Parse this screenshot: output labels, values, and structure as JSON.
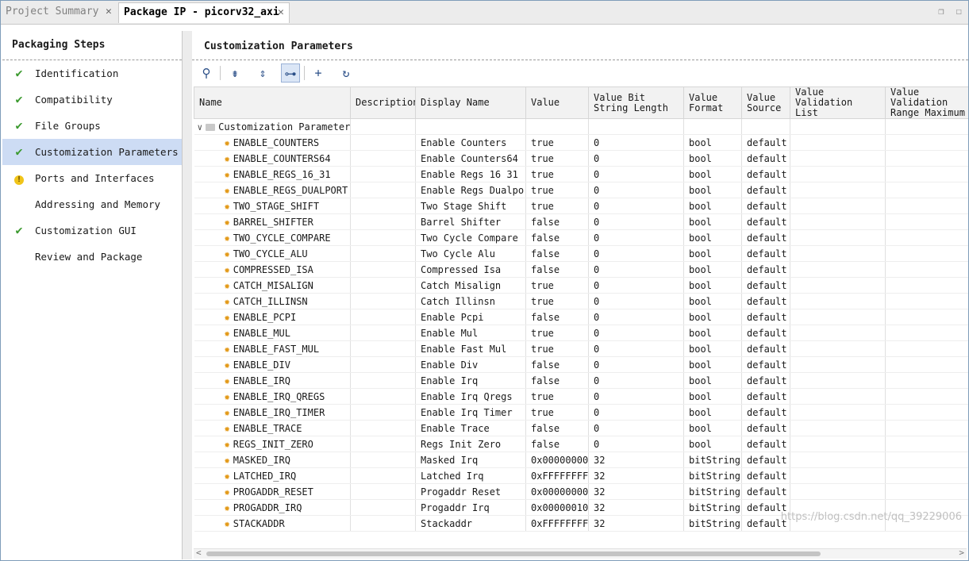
{
  "tabs": [
    {
      "label": "Project Summary",
      "close": "✕",
      "active": false
    },
    {
      "label": "Package IP - picorv32_axi",
      "close": "✕",
      "active": true
    }
  ],
  "window_buttons": {
    "restore": "❐",
    "maximize": "☐"
  },
  "steps": {
    "title": "Packaging Steps",
    "items": [
      {
        "label": "Identification",
        "status": "check"
      },
      {
        "label": "Compatibility",
        "status": "check"
      },
      {
        "label": "File Groups",
        "status": "check"
      },
      {
        "label": "Customization Parameters",
        "status": "check",
        "selected": true
      },
      {
        "label": "Ports and Interfaces",
        "status": "warning"
      },
      {
        "label": "Addressing and Memory",
        "status": "none"
      },
      {
        "label": "Customization GUI",
        "status": "check"
      },
      {
        "label": "Review and Package",
        "status": "none"
      }
    ]
  },
  "main": {
    "title": "Customization Parameters",
    "toolbar": [
      {
        "icon": "search-icon",
        "glyph": "⚲"
      },
      {
        "icon": "collapse-all-icon",
        "glyph": "⇟"
      },
      {
        "icon": "expand-all-icon",
        "glyph": "⇕"
      },
      {
        "icon": "group-hierarchy-icon",
        "glyph": "⊶"
      },
      {
        "icon": "add-icon",
        "glyph": "+"
      },
      {
        "icon": "refresh-icon",
        "glyph": "↻"
      }
    ],
    "columns": [
      "Name",
      "Description",
      "Display Name",
      "Value",
      "Value Bit String Length",
      "Value Format",
      "Value Source",
      "Value Validation List",
      "Value Validation Range Maximum"
    ],
    "group_label": "Customization Parameters",
    "rows": [
      [
        "ENABLE_COUNTERS",
        "",
        "Enable Counters",
        "true",
        "0",
        "bool",
        "default"
      ],
      [
        "ENABLE_COUNTERS64",
        "",
        "Enable Counters64",
        "true",
        "0",
        "bool",
        "default"
      ],
      [
        "ENABLE_REGS_16_31",
        "",
        "Enable Regs 16 31",
        "true",
        "0",
        "bool",
        "default"
      ],
      [
        "ENABLE_REGS_DUALPORT",
        "",
        "Enable Regs Dualport",
        "true",
        "0",
        "bool",
        "default"
      ],
      [
        "TWO_STAGE_SHIFT",
        "",
        "Two Stage Shift",
        "true",
        "0",
        "bool",
        "default"
      ],
      [
        "BARREL_SHIFTER",
        "",
        "Barrel Shifter",
        "false",
        "0",
        "bool",
        "default"
      ],
      [
        "TWO_CYCLE_COMPARE",
        "",
        "Two Cycle Compare",
        "false",
        "0",
        "bool",
        "default"
      ],
      [
        "TWO_CYCLE_ALU",
        "",
        "Two Cycle Alu",
        "false",
        "0",
        "bool",
        "default"
      ],
      [
        "COMPRESSED_ISA",
        "",
        "Compressed Isa",
        "false",
        "0",
        "bool",
        "default"
      ],
      [
        "CATCH_MISALIGN",
        "",
        "Catch Misalign",
        "true",
        "0",
        "bool",
        "default"
      ],
      [
        "CATCH_ILLINSN",
        "",
        "Catch Illinsn",
        "true",
        "0",
        "bool",
        "default"
      ],
      [
        "ENABLE_PCPI",
        "",
        "Enable Pcpi",
        "false",
        "0",
        "bool",
        "default"
      ],
      [
        "ENABLE_MUL",
        "",
        "Enable Mul",
        "true",
        "0",
        "bool",
        "default"
      ],
      [
        "ENABLE_FAST_MUL",
        "",
        "Enable Fast Mul",
        "true",
        "0",
        "bool",
        "default"
      ],
      [
        "ENABLE_DIV",
        "",
        "Enable Div",
        "false",
        "0",
        "bool",
        "default"
      ],
      [
        "ENABLE_IRQ",
        "",
        "Enable Irq",
        "false",
        "0",
        "bool",
        "default"
      ],
      [
        "ENABLE_IRQ_QREGS",
        "",
        "Enable Irq Qregs",
        "true",
        "0",
        "bool",
        "default"
      ],
      [
        "ENABLE_IRQ_TIMER",
        "",
        "Enable Irq Timer",
        "true",
        "0",
        "bool",
        "default"
      ],
      [
        "ENABLE_TRACE",
        "",
        "Enable Trace",
        "false",
        "0",
        "bool",
        "default"
      ],
      [
        "REGS_INIT_ZERO",
        "",
        "Regs Init Zero",
        "false",
        "0",
        "bool",
        "default"
      ],
      [
        "MASKED_IRQ",
        "",
        "Masked Irq",
        "0x00000000",
        "32",
        "bitString",
        "default"
      ],
      [
        "LATCHED_IRQ",
        "",
        "Latched Irq",
        "0xFFFFFFFF",
        "32",
        "bitString",
        "default"
      ],
      [
        "PROGADDR_RESET",
        "",
        "Progaddr Reset",
        "0x00000000",
        "32",
        "bitString",
        "default"
      ],
      [
        "PROGADDR_IRQ",
        "",
        "Progaddr Irq",
        "0x00000010",
        "32",
        "bitString",
        "default"
      ],
      [
        "STACKADDR",
        "",
        "Stackaddr",
        "0xFFFFFFFF",
        "32",
        "bitString",
        "default"
      ]
    ]
  },
  "scrollbar": {
    "left": "<",
    "right": ">"
  },
  "watermark": "https://blog.csdn.net/qq_39229006"
}
